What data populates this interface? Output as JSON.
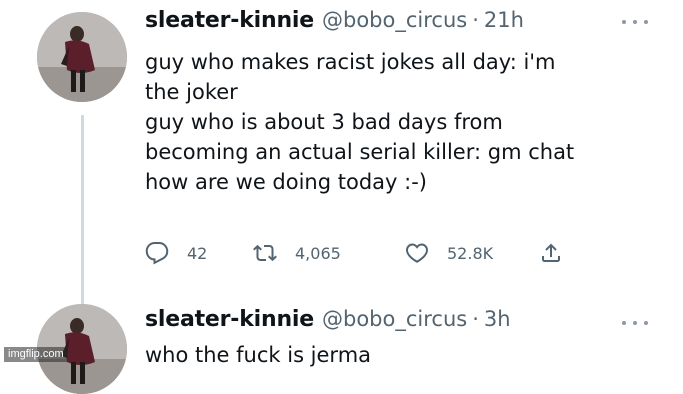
{
  "tweets": [
    {
      "display_name": "sleater-kinnie",
      "handle": "@bobo_circus",
      "separator": "·",
      "time": "21h",
      "text_lines": [
        "guy who makes racist jokes all day: i'm",
        "the joker",
        "guy who is about 3 bad days from",
        "becoming an actual serial killer: gm chat",
        "how are we doing today :-)"
      ],
      "actions": {
        "replies": "42",
        "retweets": "4,065",
        "likes": "52.8K"
      }
    },
    {
      "display_name": "sleater-kinnie",
      "handle": "@bobo_circus",
      "separator": "·",
      "time": "3h",
      "text_lines": [
        "who the fuck is jerma"
      ]
    }
  ],
  "icons": {
    "more": "more-horizontal-icon",
    "reply": "reply-bubble-icon",
    "retweet": "retweet-arrows-icon",
    "like": "heart-icon",
    "share": "share-upload-icon"
  },
  "colors": {
    "text_primary": "#0f1419",
    "text_secondary": "#536471",
    "thread_line": "#cfd9de"
  },
  "watermark": "imgflip.com"
}
